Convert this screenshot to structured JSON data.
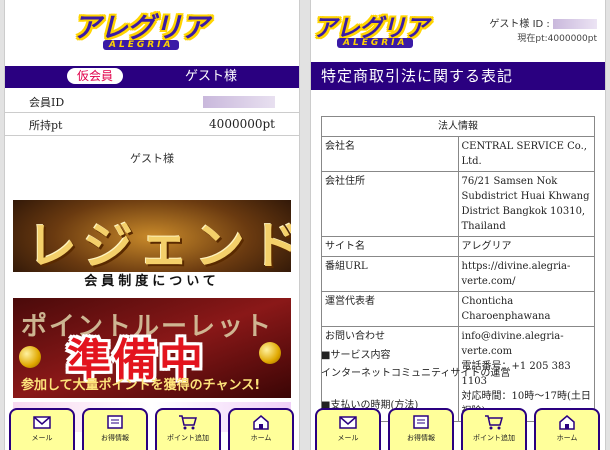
{
  "app": {
    "logo_text": "アレグリア",
    "logo_sub": "ALEGRIA"
  },
  "left": {
    "badge": "仮会員",
    "guest_name": "ゲスト様",
    "member_id_label": "会員ID",
    "points_label": "所持pt",
    "points_value": "4000000pt",
    "guest_center": "ゲスト様",
    "banner1_title": "レジェンド",
    "banner1_sub": "会員制度について",
    "banner2_top": "ポイントルーレット",
    "banner2_main": "準備中",
    "banner2_bottom": "参加して大量ポイントを獲得のチャンス!"
  },
  "right": {
    "user_id_label": "ゲスト様 ID :",
    "current_pt": "現在pt:4000000pt",
    "page_title": "特定商取引法に関する表記",
    "table": {
      "header": "法人情報",
      "rows": [
        {
          "key": "会社名",
          "value": "CENTRAL SERVICE Co., Ltd."
        },
        {
          "key": "会社住所",
          "value": "76/21 Samsen Nok Subdistrict Huai Khwang District Bangkok 10310, Thailand"
        },
        {
          "key": "サイト名",
          "value": "アレグリア"
        },
        {
          "key": "番組URL",
          "value": "https://divine.alegria-verte.com/"
        },
        {
          "key": "運営代表者",
          "value": "Chonticha Charoenphawana"
        },
        {
          "key": "お問い合わせ",
          "value": "info@divine.alegria-verte.com",
          "phone": "電話番号：+1 205 383 1103",
          "hours": "対応時間：10時〜17時(土日祝除)"
        }
      ]
    },
    "section1_title": "■サービス内容",
    "section1_body": "インターネットコミュニティサイトの運営",
    "section2_title": "■支払いの時期(方法)"
  },
  "nav": {
    "items": [
      {
        "label": "メール",
        "icon": "mail-icon"
      },
      {
        "label": "お得情報",
        "icon": "news-icon"
      },
      {
        "label": "ポイント追加",
        "icon": "cart-icon"
      },
      {
        "label": "ホーム",
        "icon": "home-icon"
      }
    ]
  },
  "colors": {
    "brand_purple": "#2a0080",
    "nav_yellow": "#ffff9a",
    "badge_red": "#e0004a"
  }
}
